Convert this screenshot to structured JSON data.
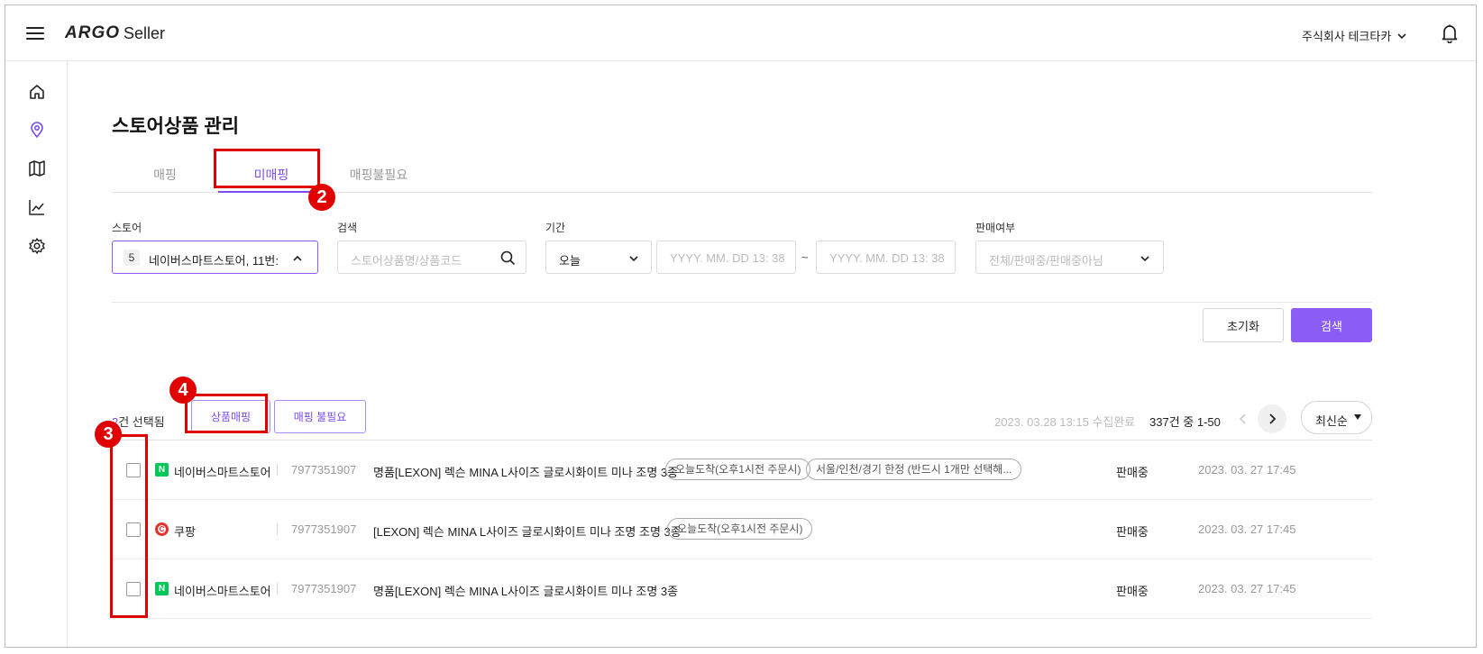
{
  "app": {
    "logo": "ARGO",
    "suffix": "Seller"
  },
  "header": {
    "company": "주식회사 테크타카"
  },
  "page": {
    "title": "스토어상품 관리"
  },
  "tabs": [
    {
      "label": "매핑",
      "active": false
    },
    {
      "label": "미매핑",
      "active": true
    },
    {
      "label": "매핑불필요",
      "active": false
    }
  ],
  "filters": {
    "store": {
      "label": "스토어",
      "count": "5",
      "value": "네이버스마트스토어, 11번:"
    },
    "search": {
      "label": "검색",
      "placeholder": "스토어상품명/상품코드"
    },
    "period": {
      "label": "기간",
      "value": "오늘",
      "from_placeholder": "YYYY. MM. DD 13: 38",
      "tilde": "~",
      "to_placeholder": "YYYY. MM. DD 13: 38"
    },
    "sale": {
      "label": "판매여부",
      "placeholder": "전체/판매중/판매중아님"
    }
  },
  "actions": {
    "reset": "초기화",
    "search": "검색"
  },
  "toolbar": {
    "selected_count": "2",
    "selected_suffix": "건 선택됨",
    "map_button": "상품매핑",
    "no_map_button": "매핑 불필요",
    "collected": "2023. 03.28 13:15 수집완료",
    "range": "337건 중 1-50",
    "sort": "최신순"
  },
  "rows": [
    {
      "store": "네이버스마트스토어",
      "logo": "N",
      "store_type": "naver",
      "code": "7977351907",
      "name": "명품[LEXON] 렉슨 MINA L사이즈 글로시화이트 미나 조명 3종",
      "tags": [
        "오늘도착(오후1시전 주문시)",
        "서울/인천/경기 한정 (반드시 1개만 선택해..."
      ],
      "status": "판매중",
      "date": "2023. 03. 27 17:45"
    },
    {
      "store": "쿠팡",
      "logo": "C",
      "store_type": "coupang",
      "code": "7977351907",
      "name": "[LEXON] 렉슨 MINA L사이즈 글로시화이트 미나 조명 조명 3종",
      "tags": [
        "오늘도착(오후1시전 주문시)"
      ],
      "status": "판매중",
      "date": "2023. 03. 27 17:45"
    },
    {
      "store": "네이버스마트스토어",
      "logo": "N",
      "store_type": "naver",
      "code": "7977351907",
      "name": "명품[LEXON] 렉슨 MINA L사이즈 글로시화이트 미나 조명 3종",
      "tags": [],
      "status": "판매중",
      "date": "2023. 03. 27 17:45"
    }
  ],
  "annotations": [
    "2",
    "3",
    "4"
  ],
  "colors": {
    "accent": "#8b5cf6",
    "annotation": "#e00000",
    "naver": "#03c75a",
    "coupang": "#e5322d"
  },
  "icons": [
    "menu-icon",
    "bell-icon",
    "home-icon",
    "location-icon",
    "map-icon",
    "chart-icon",
    "settings-icon",
    "search-icon",
    "chevron-down-icon",
    "chevron-up-icon",
    "chevron-left-icon",
    "chevron-right-icon",
    "caret-down-icon"
  ]
}
